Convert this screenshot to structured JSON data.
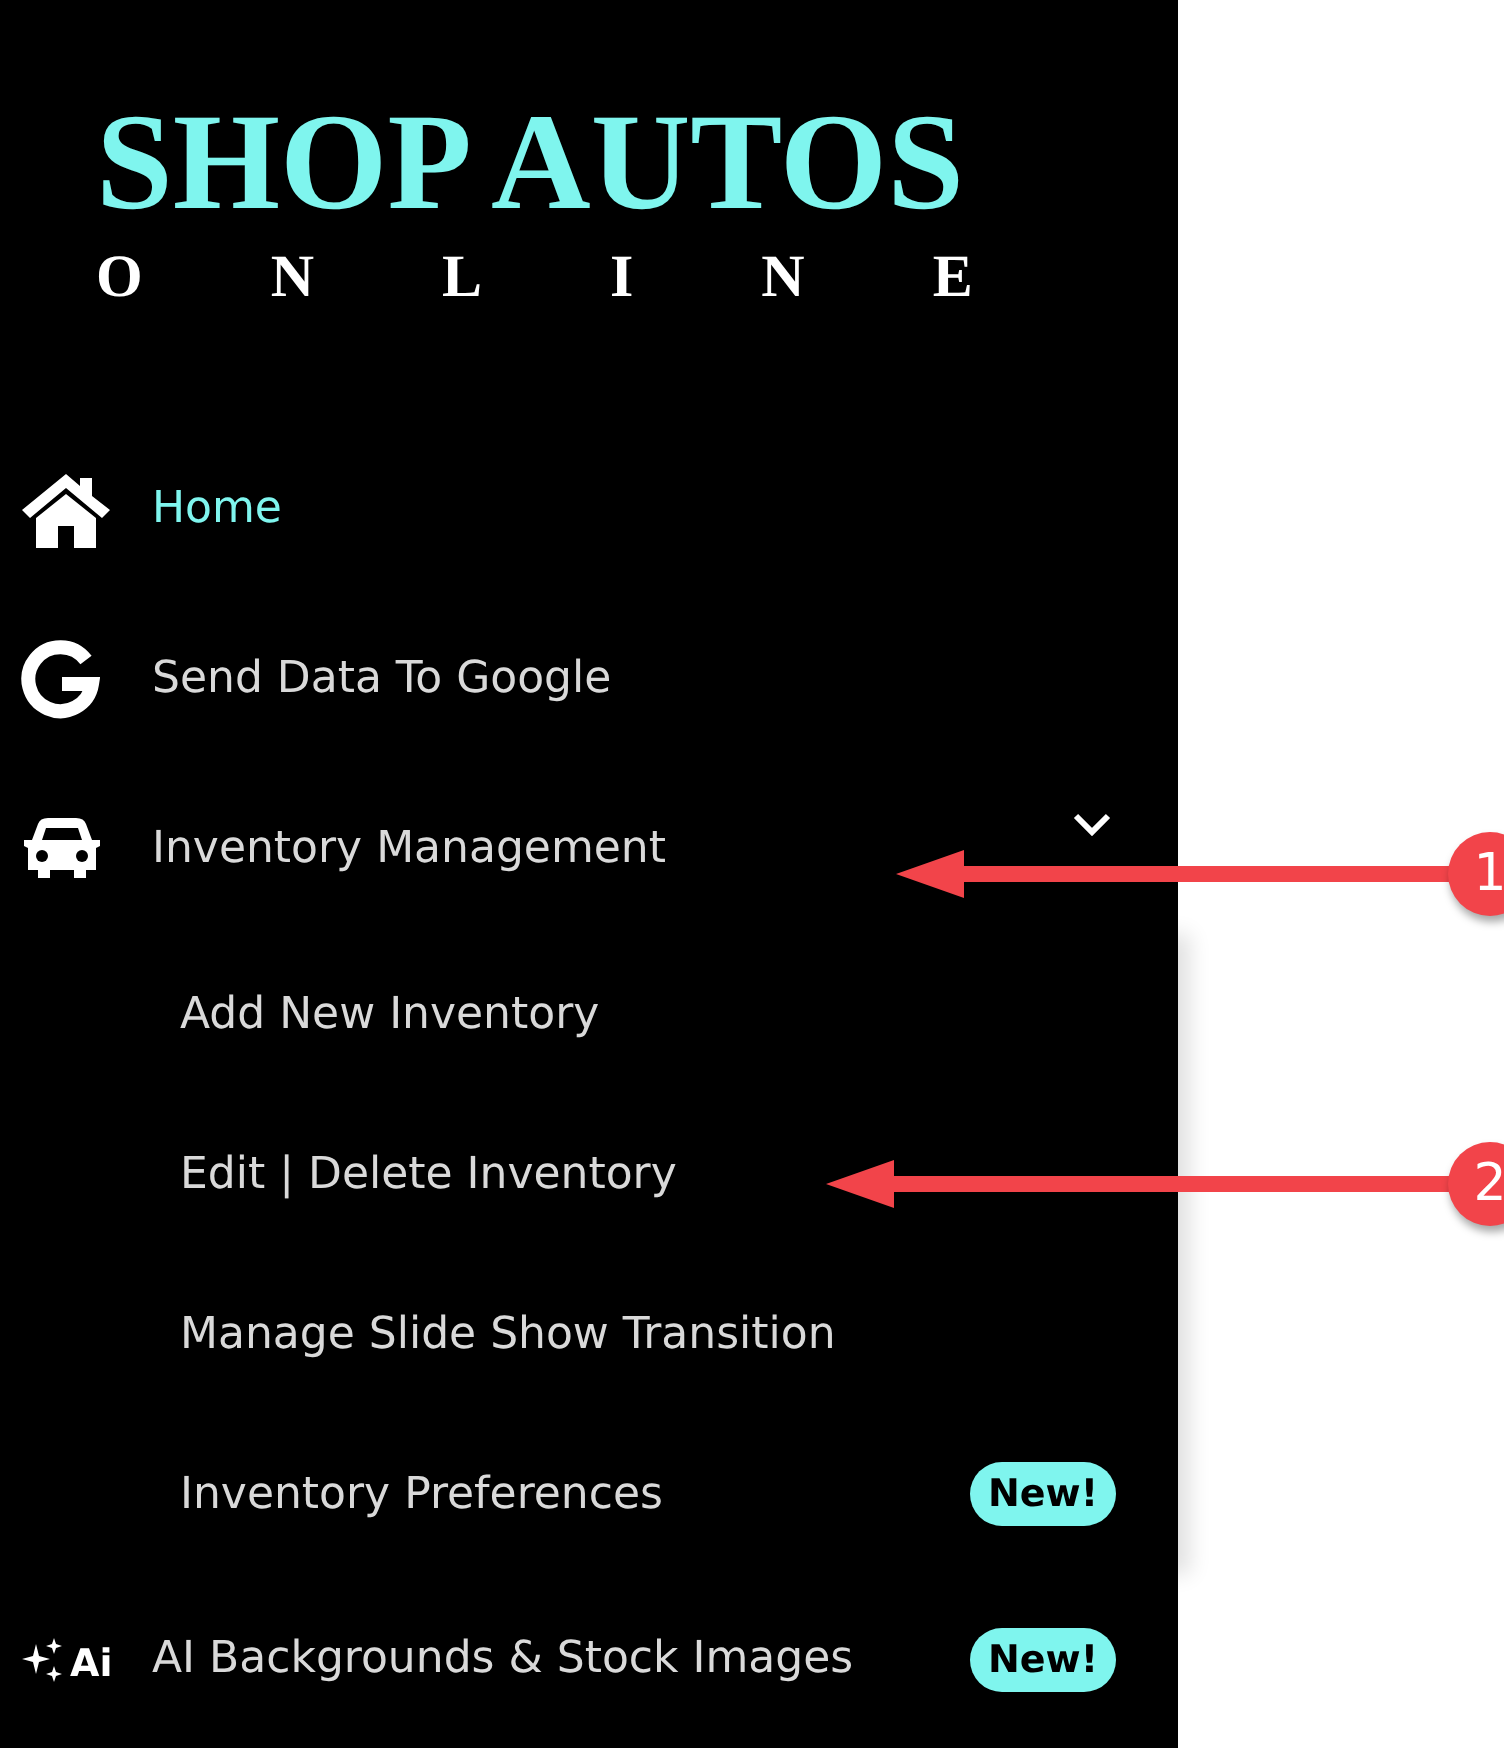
{
  "logo": {
    "title": "SHOP AUTOS",
    "subtitle": "ONLINE"
  },
  "menu": [
    {
      "label": "Home",
      "selected": true
    },
    {
      "label": "Send Data To Google",
      "selected": false
    },
    {
      "label": "Inventory Management",
      "selected": false,
      "expanded": true,
      "children": [
        {
          "label": "Add New Inventory",
          "selected": false
        },
        {
          "label": "Edit | Delete Inventory",
          "selected": false
        },
        {
          "label": "Manage Slide Show Transition",
          "selected": false
        },
        {
          "label": "Inventory Preferences",
          "selected": false,
          "badge": "New!"
        }
      ]
    },
    {
      "label": "AI Backgrounds & Stock Images",
      "selected": false,
      "icon_text": "Ai",
      "badge": "New!"
    }
  ],
  "annotations": [
    {
      "label": "1"
    },
    {
      "label": "2"
    }
  ]
}
